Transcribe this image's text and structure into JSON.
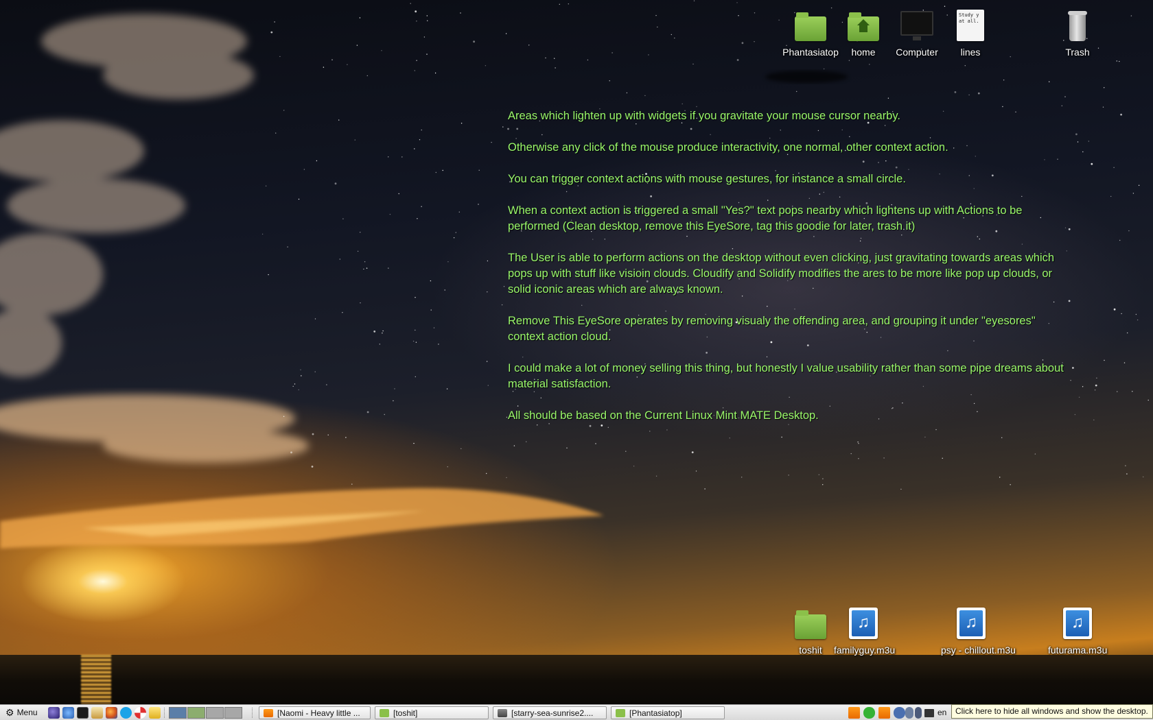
{
  "desktop": {
    "top_icons": [
      {
        "label": "Phantasiatop",
        "icon": "folder-icon"
      },
      {
        "label": "home",
        "icon": "home-folder-icon"
      },
      {
        "label": "Computer",
        "icon": "computer-icon"
      },
      {
        "label": "lines",
        "icon": "text-file-icon",
        "preview": "Study y at all."
      },
      {
        "label": "Trash",
        "icon": "trash-icon"
      }
    ],
    "bottom_icons": [
      {
        "label": "toshit",
        "icon": "folder-icon"
      },
      {
        "label": "familyguy.m3u",
        "icon": "music-playlist-icon"
      },
      {
        "label": "psy - chillout.m3u",
        "icon": "music-playlist-icon"
      },
      {
        "label": "futurama.m3u",
        "icon": "music-playlist-icon"
      }
    ],
    "notes": [
      "Areas which lighten up with widgets if you gravitate your mouse cursor nearby.",
      "Otherwise any click of the mouse produce interactivity, one normal, other context action.",
      "You can trigger context actions with mouse gestures, for instance a small circle.",
      "When a context action is triggered a small \"Yes?\" text pops nearby which lightens up with Actions to be performed (Clean desktop, remove this EyeSore, tag this goodie for later, trash it)",
      "The User is able to perform actions on the desktop without even clicking, just gravitating towards areas which pops up with stuff like visioin clouds. Cloudify and Solidify modifies the ares to be more like pop up clouds, or solid iconic areas which are always known.",
      "Remove This EyeSore operates by removing visualy the offending area, and grouping it under \"eyesores\" context action cloud.",
      "I could make a lot of money selling this thing, but honestly I value usability rather than some pipe dreams about material satisfaction.",
      "All should be based on the Current Linux Mint MATE Desktop."
    ],
    "notes_color": "#9af86a"
  },
  "taskbar": {
    "menu_label": "Menu",
    "tasks": [
      {
        "label": "[Naomi - Heavy little ...",
        "icon": "vlc-icon"
      },
      {
        "label": "[toshit]",
        "icon": "folder-icon"
      },
      {
        "label": "[starry-sea-sunrise2....",
        "icon": "image-icon"
      },
      {
        "label": "[Phantasiatop]",
        "icon": "folder-icon"
      }
    ],
    "language": "en",
    "tooltip": "Click here to hide all windows and show the desktop."
  }
}
